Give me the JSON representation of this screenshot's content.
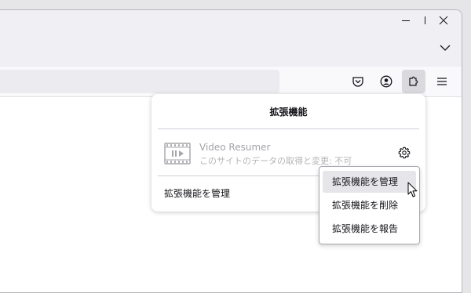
{
  "window": {
    "controls": [
      "minimize",
      "maximize",
      "close"
    ]
  },
  "toolbar": {
    "icons": [
      "pocket-icon",
      "account-icon",
      "extensions-icon",
      "menu-icon"
    ]
  },
  "extensions_panel": {
    "title": "拡張機能",
    "extension": {
      "name": "Video Resumer",
      "permission": "このサイトのデータの取得と変更: 不可"
    },
    "manage_label": "拡張機能を管理"
  },
  "context_menu": {
    "items": [
      {
        "label": "拡張機能を管理"
      },
      {
        "label": "拡張機能を削除"
      },
      {
        "label": "拡張機能を報告"
      }
    ]
  },
  "colors": {
    "titlebar": "#f0f0f4",
    "toolbar": "#f9f9fb",
    "active_button": "#dadade",
    "hover_item": "#e6e6ea"
  }
}
